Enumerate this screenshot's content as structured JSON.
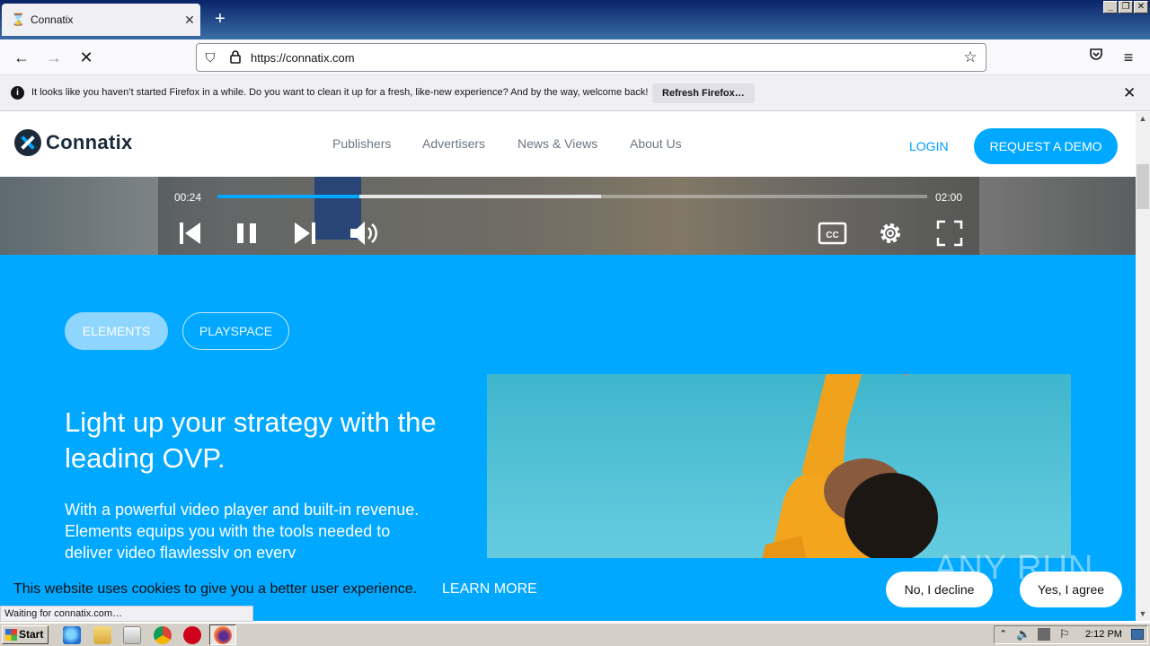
{
  "browser": {
    "tab_title": "Connatix",
    "new_tab": "+",
    "url": "https://connatix.com",
    "notification": "It looks like you haven’t started Firefox in a while. Do you want to clean it up for a fresh, like-new experience? And by the way, welcome back!",
    "refresh_button": "Refresh Firefox…",
    "status": "Waiting for connatix.com…"
  },
  "site": {
    "logo": "Connatix",
    "nav": [
      "Publishers",
      "Advertisers",
      "News & Views",
      "About Us"
    ],
    "login": "LOGIN",
    "demo": "REQUEST A DEMO"
  },
  "player": {
    "current_time": "00:24",
    "duration": "02:00",
    "progress": 0.2,
    "buffered": 0.54
  },
  "hero": {
    "tabs": [
      "ELEMENTS",
      "PLAYSPACE"
    ],
    "active_tab": "ELEMENTS",
    "title": "Light up your strategy with the leading OVP.",
    "body": "With a powerful video player and built-in revenue. Elements equips you with the tools needed to deliver video flawlessly on every"
  },
  "cookie": {
    "text": "This website uses cookies to give you a better user experience.",
    "learn_more": "LEARN MORE",
    "decline": "No, I decline",
    "agree": "Yes, I agree"
  },
  "watermark": "ANY RUN",
  "taskbar": {
    "start": "Start",
    "clock": "2:12 PM"
  },
  "colors": {
    "brand_blue": "#00a8ff",
    "logo_dark": "#1b2a3a"
  }
}
